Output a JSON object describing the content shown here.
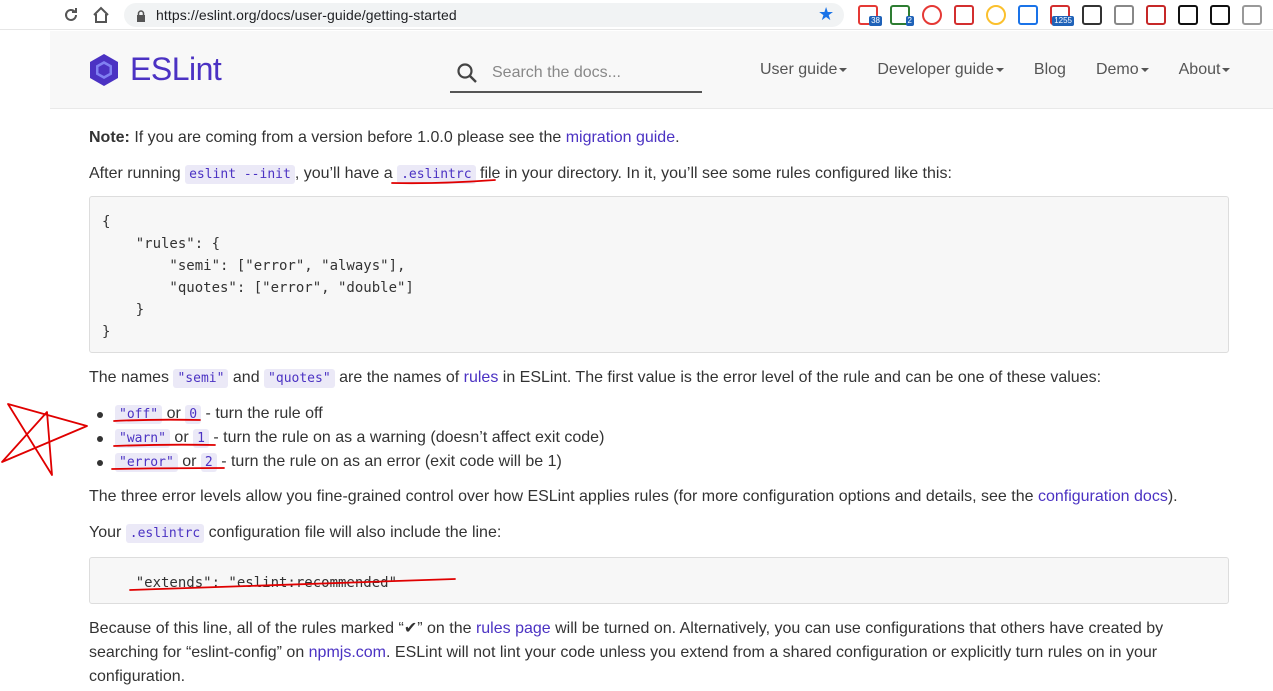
{
  "browser": {
    "url": "https://eslint.org/docs/user-guide/getting-started",
    "extensions": [
      {
        "icon": "calendar-icon",
        "badge": "38",
        "color": "#e53935"
      },
      {
        "icon": "ghost-icon",
        "badge": "2",
        "color": "#2e7d32"
      },
      {
        "icon": "adblock-icon",
        "badge": "",
        "color": "#e53935"
      },
      {
        "icon": "abp-icon",
        "badge": "",
        "color": "#d32f2f"
      },
      {
        "icon": "chrome-icon",
        "badge": "",
        "color": "#fbc02d"
      },
      {
        "icon": "translate-icon",
        "badge": "",
        "color": "#1a73e8"
      },
      {
        "icon": "gmail-icon",
        "badge": "1255",
        "color": "#d32f2f"
      },
      {
        "icon": "json-icon",
        "badge": "",
        "color": "#333333"
      },
      {
        "icon": "camera-icon",
        "badge": "",
        "color": "#888888"
      },
      {
        "icon": "ruby-icon",
        "badge": "",
        "color": "#c62828"
      },
      {
        "icon": "binary-icon",
        "badge": "",
        "color": "#111111"
      },
      {
        "icon": "qr-icon",
        "badge": "",
        "color": "#111111"
      },
      {
        "icon": "menu-icon",
        "badge": "",
        "color": "#999999"
      }
    ]
  },
  "header": {
    "logo_text": "ESLint",
    "search_placeholder": "Search the docs...",
    "menu": [
      "User guide",
      "Developer guide",
      "Blog",
      "Demo",
      "About"
    ]
  },
  "content": {
    "note_label": "Note:",
    "note_text": " If you are coming from a version before 1.0.0 please see the ",
    "migration_link": "migration guide",
    "note_end": ".",
    "after_pre": "After running ",
    "after_code1": "eslint --init",
    "after_mid": ", you’ll have a ",
    "after_code2": ".eslintrc",
    "after_end": " file in your directory. In it, you’ll see some rules configured like this:",
    "code_block_1": "{\n    \"rules\": {\n        \"semi\": [\"error\", \"always\"],\n        \"quotes\": [\"error\", \"double\"]\n    }\n}",
    "names_pre": "The names ",
    "names_code1": "\"semi\"",
    "names_and": " and ",
    "names_code2": "\"quotes\"",
    "names_mid": " are the names of ",
    "rules_link": "rules",
    "names_end": " in ESLint. The first value is the error level of the rule and can be one of these values:",
    "levels": [
      {
        "name": "\"off\"",
        "or": " or ",
        "num": "0",
        "desc": " - turn the rule off"
      },
      {
        "name": "\"warn\"",
        "or": " or ",
        "num": "1",
        "desc": " - turn the rule on as a warning (doesn’t affect exit code)"
      },
      {
        "name": "\"error\"",
        "or": " or ",
        "num": "2",
        "desc": " - turn the rule on as an error (exit code will be 1)"
      }
    ],
    "three_pre": "The three error levels allow you fine-grained control over how ESLint applies rules (for more configuration options and details, see the ",
    "config_link": "configuration docs",
    "three_end": ").",
    "your_pre": "Your ",
    "your_code": ".eslintrc",
    "your_end": " configuration file will also include the line:",
    "code_block_2": "\"extends\": \"eslint:recommended\"",
    "because_pre": "Because of this line, all of the rules marked “",
    "because_check": "✔",
    "because_mid": "” on the ",
    "rules_page_link": "rules page",
    "because_mid2": " will be turned on. Alternatively, you can use configurations that others have created by searching for “eslint-config” on ",
    "npm_link": "npmjs.com",
    "because_end": ". ESLint will not lint your code unless you extend from a shared configuration or explicitly turn rules on in your configuration."
  },
  "colors": {
    "brand": "#4b32c3",
    "annotation": "#e00000"
  }
}
